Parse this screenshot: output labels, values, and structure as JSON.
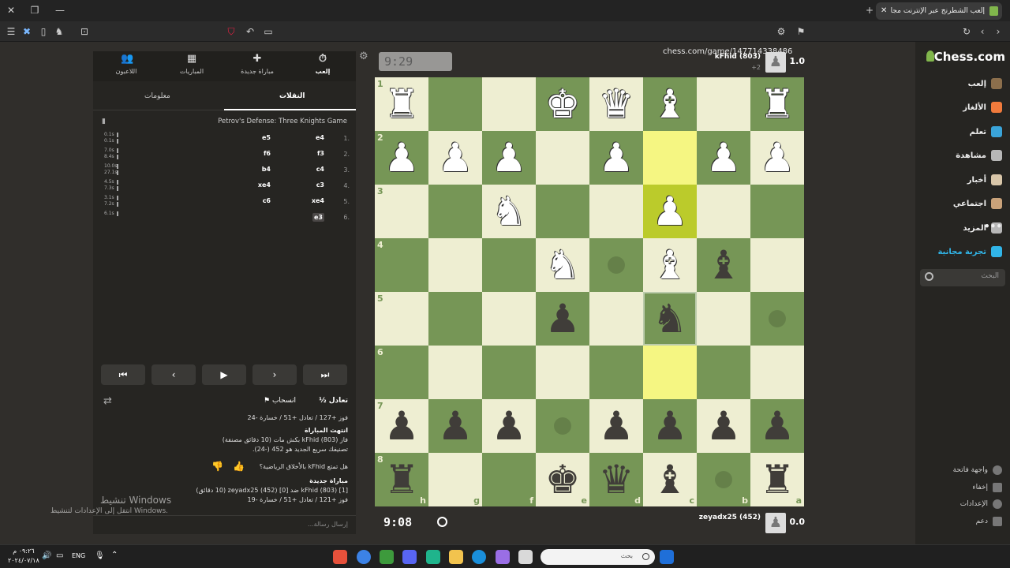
{
  "browser": {
    "tab_title": "إلعب الشطرنج عبر الإنترنت مجا",
    "url": "chess.com/game/147714338486"
  },
  "sidebar": {
    "logo": "Chess.com",
    "items": [
      {
        "label": "إلعب",
        "color": "#8c6f4c"
      },
      {
        "label": "الألغاز",
        "color": "#f07a3c"
      },
      {
        "label": "تعلم",
        "color": "#3aa4d9"
      },
      {
        "label": "مشاهدة",
        "color": "#b7b7b7"
      },
      {
        "label": "أخبار",
        "color": "#d9c6a9"
      },
      {
        "label": "اجتماعي",
        "color": "#c9a27a"
      },
      {
        "label": "المزيد",
        "color": "#b7b7b7"
      },
      {
        "label": "تجربة مجانية",
        "color": "#31b5e8"
      }
    ],
    "search_placeholder": "البحث",
    "footer": [
      "واجهة فاتحة",
      "إخفاء",
      "الإعدادات",
      "دعم"
    ]
  },
  "players": {
    "top": {
      "name": "kFhid (803)",
      "sub": "+2",
      "score": "1.0",
      "clock": "9:29"
    },
    "bottom": {
      "name": "zeyadx25 (452)",
      "score": "0.0",
      "clock": "9:08"
    }
  },
  "panel": {
    "tabs": [
      {
        "label": "إلعب",
        "icon": "⏱"
      },
      {
        "label": "مباراة جديدة",
        "icon": "✚"
      },
      {
        "label": "المباريات",
        "icon": "▦"
      },
      {
        "label": "اللاعبون",
        "icon": "👥"
      }
    ],
    "subtabs": {
      "moves": "النقلات",
      "info": "معلومات"
    },
    "opening": "Petrov's Defense: Three Knights Game",
    "moves": [
      {
        "num": "1.",
        "white": "e4",
        "black": "e5",
        "t1": "0.1s",
        "t2": "0.1s"
      },
      {
        "num": "2.",
        "white": "f3",
        "black": "f6",
        "t1": "7.0s",
        "t2": "8.4s"
      },
      {
        "num": "3.",
        "white": "c4",
        "black": "b4",
        "t1": "10.0s",
        "t2": "27.1s"
      },
      {
        "num": "4.",
        "white": "c3",
        "black": "xe4",
        "t1": "4.5s",
        "t2": "7.3s"
      },
      {
        "num": "5.",
        "white": "xe4",
        "black": "c6",
        "t1": "3.1s",
        "t2": "7.2s"
      },
      {
        "num": "6.",
        "white": "e3",
        "black": "",
        "t1": "6.1s",
        "t2": ""
      }
    ],
    "nav": [
      "⏮",
      "◀",
      "▶",
      "▶",
      "⏭"
    ],
    "actions": {
      "draw": "½ تعادل",
      "resign": "انسحاب"
    },
    "messages": [
      "فوز +127 / تعادل +51 / خسارة -24",
      "انتهت المباراة",
      "فاز kFhid (803) بكش مات (10 دقائق مصنفة)",
      "تصنيفك سريع الجديد هو 452 (-24).",
      "هل تمتع kFhid بالأخلاق الرياضية؟",
      "مباراة جديدة",
      "[1] kFhid (803) ضد [0] zeyadx25 (452) (10 دقائق)",
      "فوز +121 / تعادل +51 / خسارة -19"
    ],
    "chat_placeholder": "إرسال رسالة..."
  },
  "watermark": {
    "line1": "تنشيط Windows",
    "line2": "انتقل إلى الإعدادات لتنشيط Windows."
  },
  "taskbar": {
    "search": "بحث",
    "lang": "ENG",
    "time": "٠٩:٢٦ م",
    "date": "٢٠٢٤/٠٧/١٨"
  },
  "board": {
    "ranks": [
      "1",
      "2",
      "3",
      "4",
      "5",
      "6",
      "7",
      "8"
    ],
    "files": [
      "h",
      "g",
      "f",
      "e",
      "d",
      "c",
      "b",
      "a"
    ],
    "rows": [
      [
        "wR",
        "",
        "",
        "wK",
        "wQ",
        "wB",
        "",
        "wR"
      ],
      [
        "wP",
        "wP",
        "wP",
        "",
        "wP",
        "",
        "wP",
        "wP"
      ],
      [
        "",
        "",
        "wN",
        "",
        "",
        "wP",
        "",
        ""
      ],
      [
        "",
        "",
        "",
        "wN",
        "dot",
        "wB",
        "bB",
        ""
      ],
      [
        "",
        "",
        "",
        "bP",
        "",
        "bN",
        "",
        "dot"
      ],
      [
        "",
        "",
        "",
        "",
        "",
        "",
        "",
        ""
      ],
      [
        "bP",
        "bP",
        "bP",
        "dot",
        "bP",
        "bP",
        "bP",
        "bP"
      ],
      [
        "bR",
        "",
        "",
        "bK",
        "bQ",
        "bB",
        "dot",
        "bR"
      ]
    ],
    "highlights": {
      "light": [
        [
          1,
          5
        ],
        [
          5,
          5
        ]
      ],
      "dark": [
        [
          2,
          5
        ]
      ],
      "outline": [
        [
          4,
          5
        ]
      ]
    }
  }
}
